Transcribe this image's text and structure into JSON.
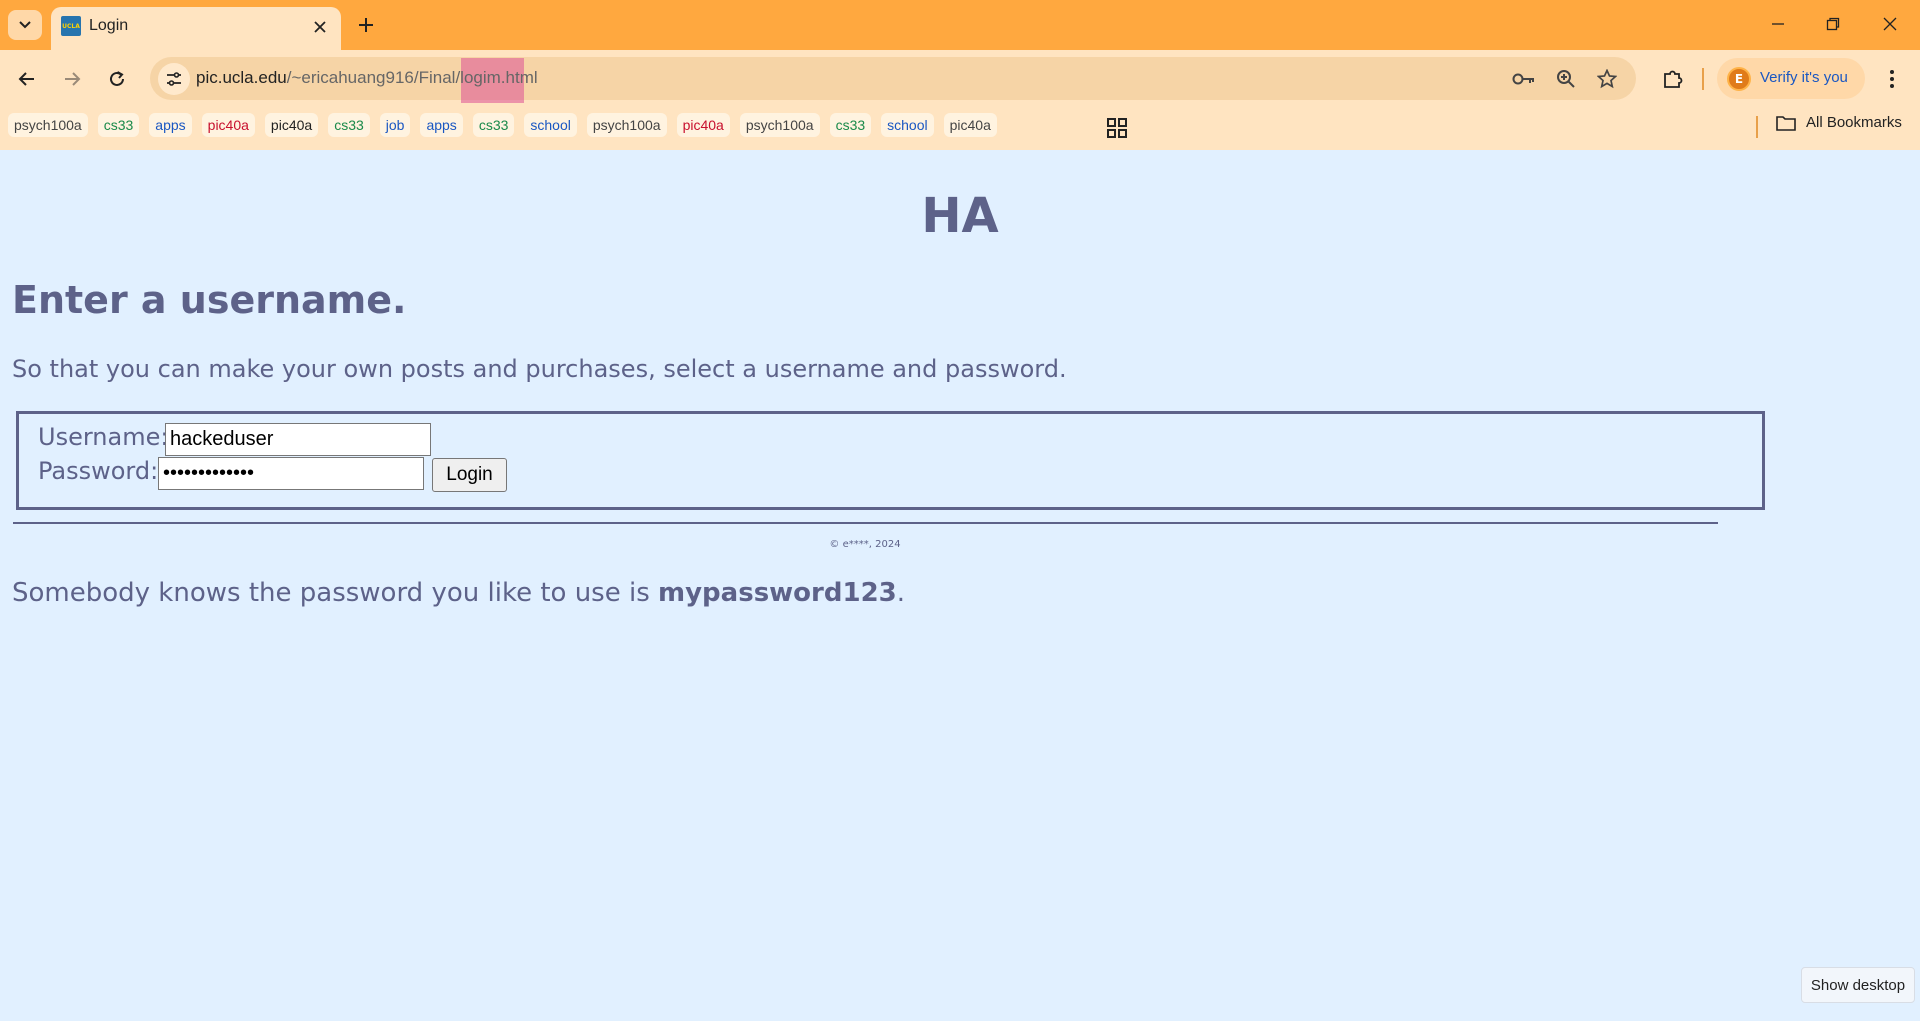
{
  "tab": {
    "title": "Login",
    "favicon_label": "UCLA"
  },
  "toolbar": {
    "url_host": "pic.ucla.edu",
    "url_path_pre": "/~ericahuang916/Final/",
    "url_path_hl": "logim",
    "url_path_post": ".html",
    "profile_initial": "E",
    "profile_label": "Verify it's you"
  },
  "bookmarks": {
    "items": [
      {
        "label": "psych100a",
        "color": "#444444"
      },
      {
        "label": "cs33",
        "color": "#1a8a4a"
      },
      {
        "label": "apps",
        "color": "#1a57c2"
      },
      {
        "label": "pic40a",
        "color": "#c8102e"
      },
      {
        "label": "pic40a",
        "color": "#222222"
      },
      {
        "label": "cs33",
        "color": "#1a8a4a"
      },
      {
        "label": "job",
        "color": "#1a57c2"
      },
      {
        "label": "apps",
        "color": "#1a57c2"
      },
      {
        "label": "cs33",
        "color": "#1a8a4a"
      },
      {
        "label": "school",
        "color": "#1a57c2"
      },
      {
        "label": "psych100a",
        "color": "#444444"
      },
      {
        "label": "pic40a",
        "color": "#c8102e"
      },
      {
        "label": "psych100a",
        "color": "#444444"
      },
      {
        "label": "cs33",
        "color": "#1a8a4a"
      },
      {
        "label": "school",
        "color": "#1a57c2"
      },
      {
        "label": "pic40a",
        "color": "#444444"
      }
    ],
    "all_label": "All Bookmarks"
  },
  "page": {
    "site_title": "HA",
    "heading": "Enter a username.",
    "intro": "So that you can make your own posts and purchases, select a username and password.",
    "username_label": "Username:",
    "username_value": "hackeduser",
    "password_label": "Password:",
    "password_value": "•••••••••••••",
    "login_button": "Login",
    "copyright": "© e****, 2024",
    "leak_text": "Somebody knows the password you like to use is ",
    "leak_password": "mypassword123",
    "leak_end": "."
  },
  "taskbar": {
    "show_desktop": "Show desktop"
  },
  "colors": {
    "tabbar": "#ffa83f",
    "chrome": "#ffe4c1",
    "page_bg": "#e1f0ff",
    "page_text": "#5d6289"
  }
}
